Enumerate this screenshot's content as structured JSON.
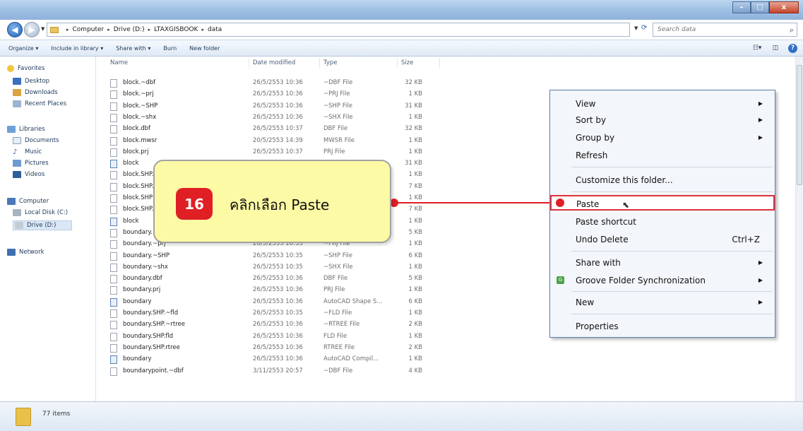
{
  "window": {
    "min": "–",
    "max": "□",
    "close": "x"
  },
  "address": {
    "crumbs": [
      "Computer",
      "Drive (D:)",
      "LTAXGISBOOK",
      "data"
    ],
    "search_placeholder": "Search data"
  },
  "toolbar": {
    "organize": "Organize ▾",
    "include": "Include in library ▾",
    "share": "Share with ▾",
    "burn": "Burn",
    "new_folder": "New folder"
  },
  "nav": {
    "favorites": "Favorites",
    "desktop": "Desktop",
    "downloads": "Downloads",
    "recent": "Recent Places",
    "libraries": "Libraries",
    "documents": "Documents",
    "music": "Music",
    "pictures": "Pictures",
    "videos": "Videos",
    "computer": "Computer",
    "local_disk": "Local Disk (C:)",
    "drive_d": "Drive (D:)",
    "network": "Network"
  },
  "columns": {
    "name": "Name",
    "date": "Date modified",
    "type": "Type",
    "size": "Size"
  },
  "files": [
    {
      "name": "block.~dbf",
      "date": "26/5/2553 10:36",
      "type": "~DBF File",
      "size": "32 KB"
    },
    {
      "name": "block.~prj",
      "date": "26/5/2553 10:36",
      "type": "~PRJ File",
      "size": "1 KB"
    },
    {
      "name": "block.~SHP",
      "date": "26/5/2553 10:36",
      "type": "~SHP File",
      "size": "31 KB"
    },
    {
      "name": "block.~shx",
      "date": "26/5/2553 10:36",
      "type": "~SHX File",
      "size": "1 KB"
    },
    {
      "name": "block.dbf",
      "date": "26/5/2553 10:37",
      "type": "DBF File",
      "size": "32 KB"
    },
    {
      "name": "block.mwsr",
      "date": "20/5/2553 14:39",
      "type": "MWSR File",
      "size": "1 KB"
    },
    {
      "name": "block.prj",
      "date": "26/5/2553 10:37",
      "type": "PRJ File",
      "size": "1 KB"
    },
    {
      "name": "block",
      "date": "",
      "type": "",
      "size": "31 KB"
    },
    {
      "name": "block.SHP.",
      "date": "",
      "type": "",
      "size": "1 KB"
    },
    {
      "name": "block.SHP.",
      "date": "",
      "type": "",
      "size": "7 KB"
    },
    {
      "name": "block.SHP",
      "date": "",
      "type": "",
      "size": "1 KB"
    },
    {
      "name": "block.SHP.",
      "date": "",
      "type": "",
      "size": "7 KB"
    },
    {
      "name": "block",
      "date": "",
      "type": "",
      "size": "1 KB"
    },
    {
      "name": "boundary.~",
      "date": "",
      "type": "",
      "size": "5 KB"
    },
    {
      "name": "boundary.~prj",
      "date": "26/5/2553 10:35",
      "type": "~PRJ File",
      "size": "1 KB"
    },
    {
      "name": "boundary.~SHP",
      "date": "26/5/2553 10:35",
      "type": "~SHP File",
      "size": "6 KB"
    },
    {
      "name": "boundary.~shx",
      "date": "26/5/2553 10:35",
      "type": "~SHX File",
      "size": "1 KB"
    },
    {
      "name": "boundary.dbf",
      "date": "26/5/2553 10:36",
      "type": "DBF File",
      "size": "5 KB"
    },
    {
      "name": "boundary.prj",
      "date": "26/5/2553 10:36",
      "type": "PRJ File",
      "size": "1 KB"
    },
    {
      "name": "boundary",
      "date": "26/5/2553 10:36",
      "type": "AutoCAD Shape S...",
      "size": "6 KB"
    },
    {
      "name": "boundary.SHP.~fld",
      "date": "26/5/2553 10:35",
      "type": "~FLD File",
      "size": "1 KB"
    },
    {
      "name": "boundary.SHP.~rtree",
      "date": "26/5/2553 10:36",
      "type": "~RTREE File",
      "size": "2 KB"
    },
    {
      "name": "boundary.SHP.fld",
      "date": "26/5/2553 10:36",
      "type": "FLD File",
      "size": "1 KB"
    },
    {
      "name": "boundary.SHP.rtree",
      "date": "26/5/2553 10:36",
      "type": "RTREE File",
      "size": "2 KB"
    },
    {
      "name": "boundary",
      "date": "26/5/2553 10:36",
      "type": "AutoCAD Compil...",
      "size": "1 KB"
    },
    {
      "name": "boundarypoint.~dbf",
      "date": "3/11/2553 20:57",
      "type": "~DBF File",
      "size": "4 KB"
    }
  ],
  "status": {
    "count": "77 items"
  },
  "menu": {
    "view": "View",
    "sort_by": "Sort by",
    "group_by": "Group by",
    "refresh": "Refresh",
    "customize": "Customize this folder...",
    "paste": "Paste",
    "paste_shortcut": "Paste shortcut",
    "undo_delete": "Undo Delete",
    "undo_shortcut": "Ctrl+Z",
    "share_with": "Share with",
    "groove": "Groove Folder Synchronization",
    "new": "New",
    "properties": "Properties"
  },
  "callout": {
    "step": "16",
    "text": "คลิกเลือก  Paste"
  },
  "colors": {
    "highlight": "#e01f25",
    "callout_bg": "#fdfaa5"
  }
}
